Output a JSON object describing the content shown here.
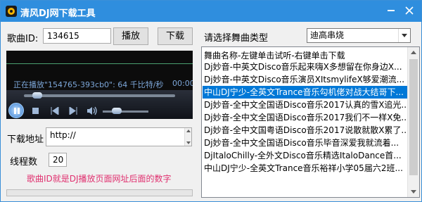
{
  "window": {
    "title": "清风DJ网下载工具"
  },
  "form": {
    "song_id_label": "歌曲ID:",
    "song_id_value": "134615",
    "play_button": "播放",
    "download_button": "下载",
    "dance_type_label": "请选择舞曲类型",
    "dance_type_value": "迪高串烧",
    "download_addr_label": "下载地址",
    "download_addr_value": "http://",
    "threads_label": "线程数",
    "threads_value": "20",
    "hint": "歌曲ID就是DJ播放页面网址后面的数字"
  },
  "player": {
    "status": "正在播放\"154765-393cb0\": 64 千比特/秒",
    "time": "00:00",
    "seek_position": 0.05,
    "volume_level": 0.25
  },
  "list": {
    "header": "舞曲名称-左键单击试听-右键单击下载",
    "selected_index": 2,
    "items": [
      "Dj妙音-中英文Disco音乐起来嗨X多想留在你身边X...",
      "Dj妙音-中英文Disco音乐演员XItsmylifeX够爱潮流...",
      "中山DJ宁少-全英文Trance音乐勾机佬对战大结哥下...",
      "Dj妙音-全中文全国语Disco音乐2017认真的雪X追光...",
      "Dj妙音-全中文全国语Disco音乐2017我们不一样X免...",
      "Dj妙音-全中文国粤语Disco音乐2017说散就散X累了...",
      "Dj妙音-全中文全国语Disco音乐毕音深爱我就流着...",
      "DjItaloChilly-全外文Disco音乐精选ItaloDance首...",
      "中山DJ宁少-全英文Trance音乐裕祥小学05届六2班..."
    ]
  },
  "colors": {
    "titlebar": "#2f8ede",
    "hint": "#e0306f",
    "selection": "#0078d7"
  }
}
